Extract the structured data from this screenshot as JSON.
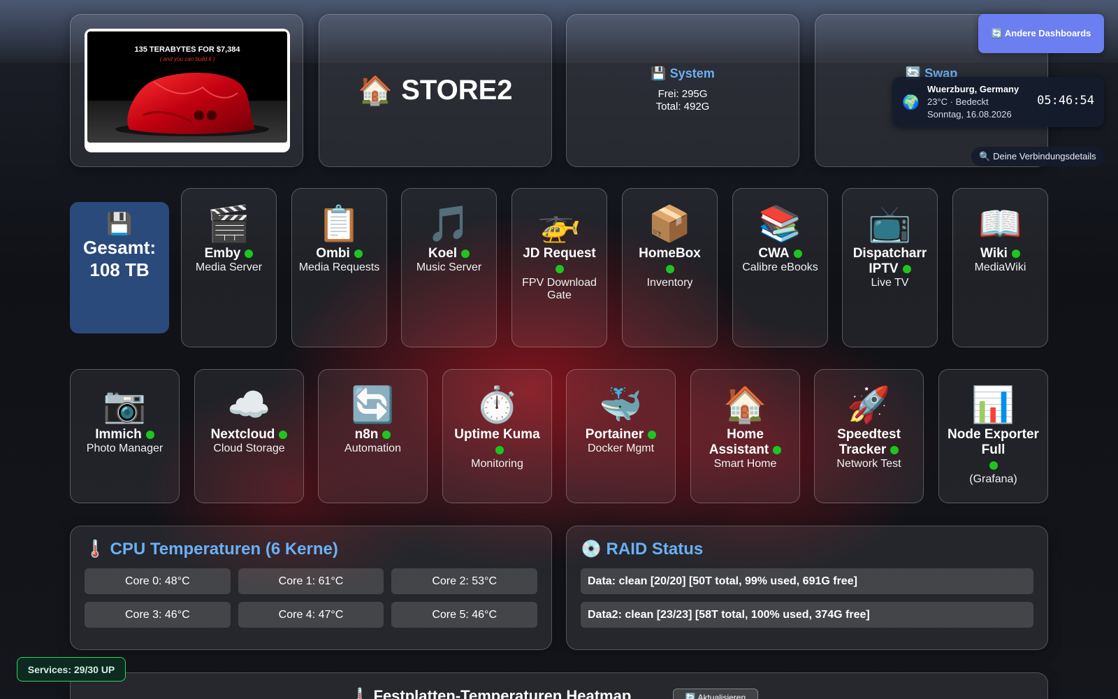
{
  "header": {
    "logo_promo_line1": "135 TERABYTES FOR  $7,384",
    "logo_promo_line2": "( and you can build it )",
    "title_icon": "🏠",
    "title": "STORE2"
  },
  "system": {
    "heading": "💾 System",
    "free": "Frei: 295G",
    "total": "Total: 492G"
  },
  "swap": {
    "heading": "🔄 Swap"
  },
  "dashboards_button": "🔄 Andere Dashboards",
  "weather": {
    "icon": "🌍",
    "city": "Wuerzburg, Germany",
    "condition": "23°C · Bedeckt",
    "date": "Sonntag, 16.08.2026",
    "time": "05:46:54"
  },
  "connection_button": "🔍 Deine Verbindungsdetails",
  "total": {
    "icon": "💾",
    "label": "Gesamt:",
    "value": "108 TB"
  },
  "services_row1": [
    {
      "icon": "🎬",
      "name": "Emby",
      "desc": "Media Server",
      "status": "up"
    },
    {
      "icon": "📋",
      "name": "Ombi",
      "desc": "Media Requests",
      "status": "up"
    },
    {
      "icon": "🎵",
      "name": "Koel",
      "desc": "Music Server",
      "status": "up"
    },
    {
      "icon": "🚁",
      "name": "JD Request",
      "desc": "FPV Download Gate",
      "status": "up"
    },
    {
      "icon": "📦",
      "name": "HomeBox",
      "desc": "Inventory",
      "status": "up"
    },
    {
      "icon": "📚",
      "name": "CWA",
      "desc": "Calibre eBooks",
      "status": "up"
    },
    {
      "icon": "📺",
      "name": "Dispatcharr IPTV",
      "desc": "Live TV",
      "status": "up"
    },
    {
      "icon": "📖",
      "name": "Wiki",
      "desc": "MediaWiki",
      "status": "up"
    }
  ],
  "services_row2": [
    {
      "icon": "📷",
      "name": "Immich",
      "desc": "Photo Manager",
      "status": "up"
    },
    {
      "icon": "☁️",
      "name": "Nextcloud",
      "desc": "Cloud Storage",
      "status": "up"
    },
    {
      "icon": "🔄",
      "name": "n8n",
      "desc": "Automation",
      "status": "up"
    },
    {
      "icon": "⏱️",
      "name": "Uptime Kuma",
      "desc": "Monitoring",
      "status": "up"
    },
    {
      "icon": "🐳",
      "name": "Portainer",
      "desc": "Docker Mgmt",
      "status": "up"
    },
    {
      "icon": "🏠",
      "name": "Home Assistant",
      "desc": "Smart Home",
      "status": "up"
    },
    {
      "icon": "🚀",
      "name": "Speedtest Tracker",
      "desc": "Network Test",
      "status": "up"
    },
    {
      "icon": "📊",
      "name": "Node Exporter Full",
      "desc": "(Grafana)",
      "status": "up"
    }
  ],
  "cpu": {
    "title": "🌡️ CPU Temperaturen (6 Kerne)",
    "cores": [
      "Core 0: 48°C",
      "Core 1: 61°C",
      "Core 2: 53°C",
      "Core 3: 46°C",
      "Core 4: 47°C",
      "Core 5: 46°C"
    ]
  },
  "raid": {
    "title": "💿 RAID Status",
    "arrays": [
      "Data: clean [20/20] [50T total, 99% used, 691G free]",
      "Data2: clean [23/23] [58T total, 100% used, 374G free]"
    ]
  },
  "services_badge": "Services: 29/30 UP",
  "heatmap": {
    "title": "🌡️ Festplatten-Temperaturen Heatmap",
    "refresh_label": "🔄 Aktualisieren"
  },
  "colors": {
    "accent_blue": "#6ab0f5",
    "status_up": "#1ec51e",
    "button_purple": "#6b7ff0",
    "total_tile": "#2a4a7c"
  }
}
